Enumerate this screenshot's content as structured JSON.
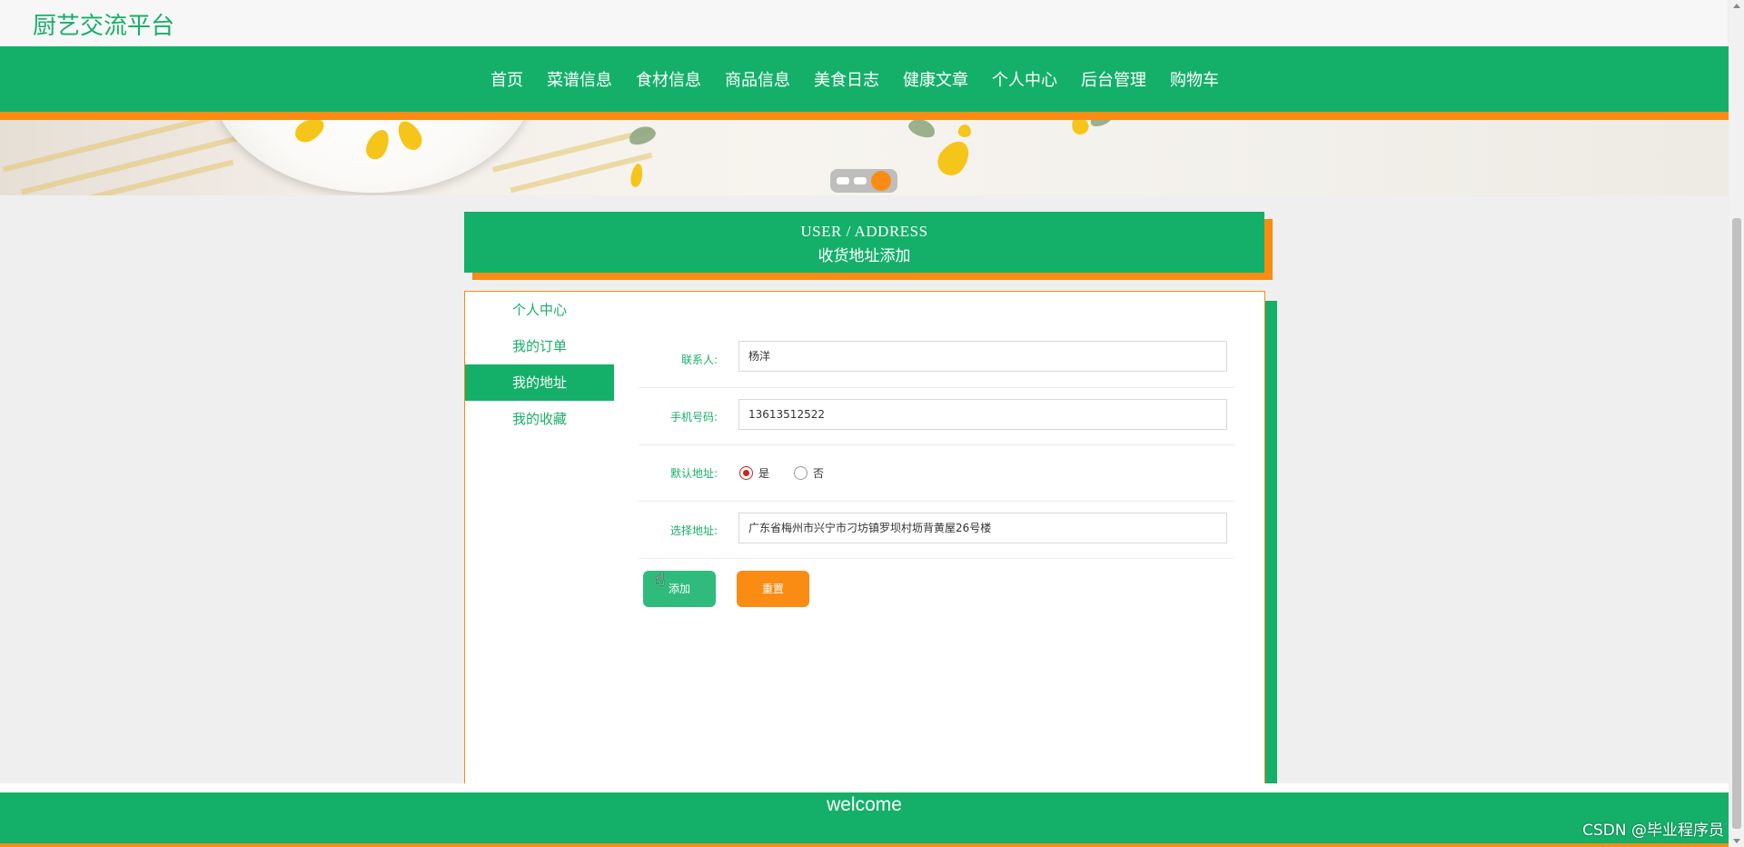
{
  "brand": "厨艺交流平台",
  "nav": {
    "items": [
      "首页",
      "菜谱信息",
      "食材信息",
      "商品信息",
      "美食日志",
      "健康文章",
      "个人中心",
      "后台管理",
      "购物车"
    ]
  },
  "section": {
    "title_en": "USER / ADDRESS",
    "title_cn": "收货地址添加"
  },
  "sidebar": {
    "items": [
      "个人中心",
      "我的订单",
      "我的地址",
      "我的收藏"
    ],
    "active": "我的地址"
  },
  "form": {
    "contact_label": "联系人:",
    "contact_value": "杨洋",
    "phone_label": "手机号码:",
    "phone_value": "13613512522",
    "default_label": "默认地址:",
    "default_yes": "是",
    "default_no": "否",
    "default_selected": "是",
    "address_label": "选择地址:",
    "address_value": "广东省梅州市兴宁市刁坊镇罗坝村坜背黄屋26号楼",
    "add_button": "添加",
    "reset_button": "重置"
  },
  "footer": {
    "text": "welcome",
    "watermark": "CSDN @毕业程序员"
  },
  "colors": {
    "primary": "#14b06a",
    "accent": "#fb8c13",
    "label": "#1aae6a"
  }
}
